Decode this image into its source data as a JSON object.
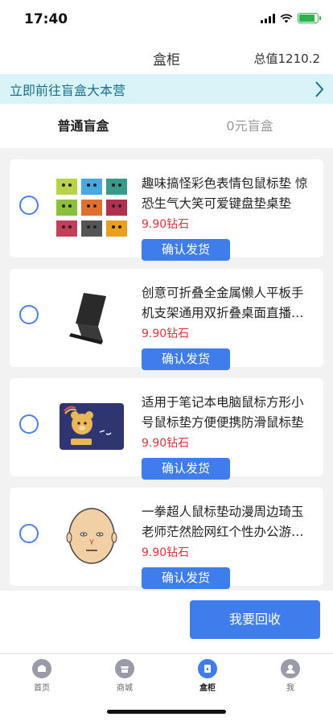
{
  "status_bar": {
    "time": "17:40"
  },
  "header": {
    "title": "盒柜",
    "total_value": "总值1210.2"
  },
  "banner": {
    "text": "立即前往盲盒大本营"
  },
  "tabs": [
    {
      "label": "普通盲盒",
      "active": true
    },
    {
      "label": "0元盲盒",
      "active": false
    }
  ],
  "items": [
    {
      "title": "趣味搞怪彩色表情包鼠标垫 惊恐生气大笑可爱键盘垫桌垫",
      "price": "9.90钻石",
      "button": "确认发货",
      "icon": "emoji-mousepad-icon"
    },
    {
      "title": "创意可折叠全金属懒人平板手机支架通用双折叠桌面直播支架",
      "price": "9.90钻石",
      "button": "确认发货",
      "icon": "phone-stand-icon"
    },
    {
      "title": "适用于笔记本电脑鼠标方形小号鼠标垫方便便携防滑鼠标垫",
      "price": "9.90钻石",
      "button": "确认发货",
      "icon": "bear-mousepad-icon"
    },
    {
      "title": "一拳超人鼠标垫动漫周边琦玉老师茫然脸网红个性办公游戏垫",
      "price": "9.90钻石",
      "button": "确认发货",
      "icon": "saitama-mousepad-icon"
    }
  ],
  "footer": {
    "recycle_label": "我要回收"
  },
  "tabbar": [
    {
      "label": "首页",
      "icon": "home-icon",
      "active": false
    },
    {
      "label": "商城",
      "icon": "shop-icon",
      "active": false
    },
    {
      "label": "盒柜",
      "icon": "box-icon",
      "active": true
    },
    {
      "label": "我",
      "icon": "user-icon",
      "active": false
    }
  ],
  "colors": {
    "accent": "#3f7ded",
    "price": "#e0343b",
    "banner_bg": "#d9f4f8",
    "banner_text": "#1a6f8a"
  }
}
